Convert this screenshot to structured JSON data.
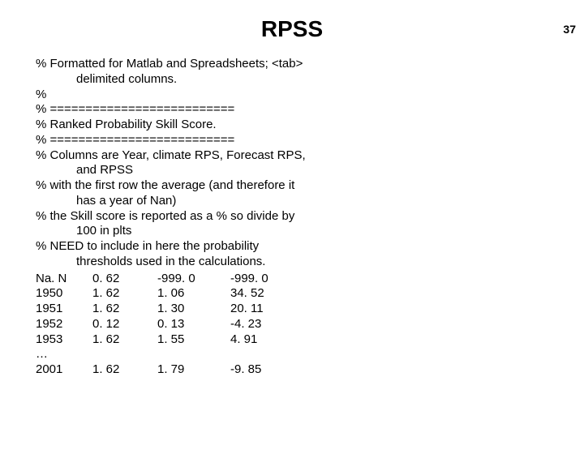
{
  "page_number": "37",
  "title": "RPSS",
  "comments": [
    "% Formatted for Matlab and Spreadsheets; <tab>",
    "delimited columns.",
    "%",
    "% ==========================",
    "% Ranked Probability Skill Score.",
    "% ==========================",
    "%  Columns are Year, climate RPS, Forecast RPS,",
    "and RPSS",
    "% with the first row the average (and therefore it",
    "has a year of Nan)",
    "% the Skill score is reported as a % so divide by",
    "100 in plts",
    "% NEED to include in here the probability",
    "thresholds used in the calculations."
  ],
  "indent_flags": [
    false,
    true,
    false,
    false,
    false,
    false,
    false,
    true,
    false,
    true,
    false,
    true,
    false,
    true
  ],
  "rows": [
    {
      "c1": "Na. N",
      "c2": "0. 62",
      "c3": "-999. 0",
      "c4": "-999. 0"
    },
    {
      "c1": "1950",
      "c2": "1. 62",
      "c3": "1. 06",
      "c4": "34. 52"
    },
    {
      "c1": "1951",
      "c2": "1. 62",
      "c3": "1. 30",
      "c4": "20. 11"
    },
    {
      "c1": "1952",
      "c2": "0. 12",
      "c3": "0. 13",
      "c4": "-4. 23"
    },
    {
      "c1": "1953",
      "c2": "1. 62",
      "c3": "1. 55",
      "c4": "4. 91"
    }
  ],
  "ellipsis": "…",
  "last_row": {
    "c1": "2001",
    "c2": "1. 62",
    "c3": "1. 79",
    "c4": "-9. 85"
  }
}
